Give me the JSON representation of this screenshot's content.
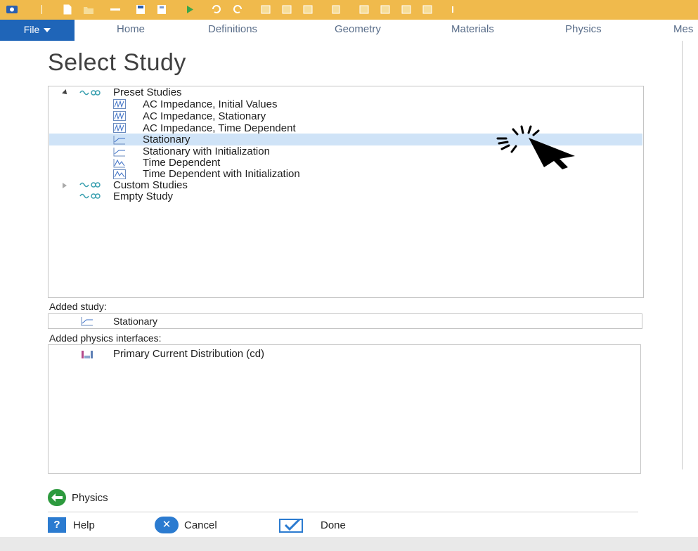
{
  "ribbon": {
    "file_label": "File",
    "tabs": [
      "Home",
      "Definitions",
      "Geometry",
      "Materials",
      "Physics",
      "Mes"
    ]
  },
  "dialog": {
    "title": "Select Study",
    "tree": {
      "preset_group": "Preset Studies",
      "preset_items": [
        "AC Impedance, Initial Values",
        "AC Impedance, Stationary",
        "AC Impedance, Time Dependent",
        "Stationary",
        "Stationary with Initialization",
        "Time Dependent",
        "Time Dependent with Initialization"
      ],
      "selected_item": "Stationary",
      "custom_group": "Custom Studies",
      "empty_study": "Empty Study"
    },
    "added_study_label": "Added study:",
    "added_study_value": "Stationary",
    "added_physics_label": "Added physics interfaces:",
    "added_physics_items": [
      "Primary Current Distribution (cd)"
    ]
  },
  "buttons": {
    "physics": "Physics",
    "help": "Help",
    "cancel": "Cancel",
    "done": "Done"
  },
  "icons": {
    "help_glyph": "?",
    "cancel_glyph": "✕"
  },
  "colors": {
    "toolbar": "#f0ba4c",
    "file_tab": "#1f65b8",
    "selection": "#cfe3f7",
    "accent_blue": "#2b7bd0",
    "back_green": "#2d9a3e"
  }
}
